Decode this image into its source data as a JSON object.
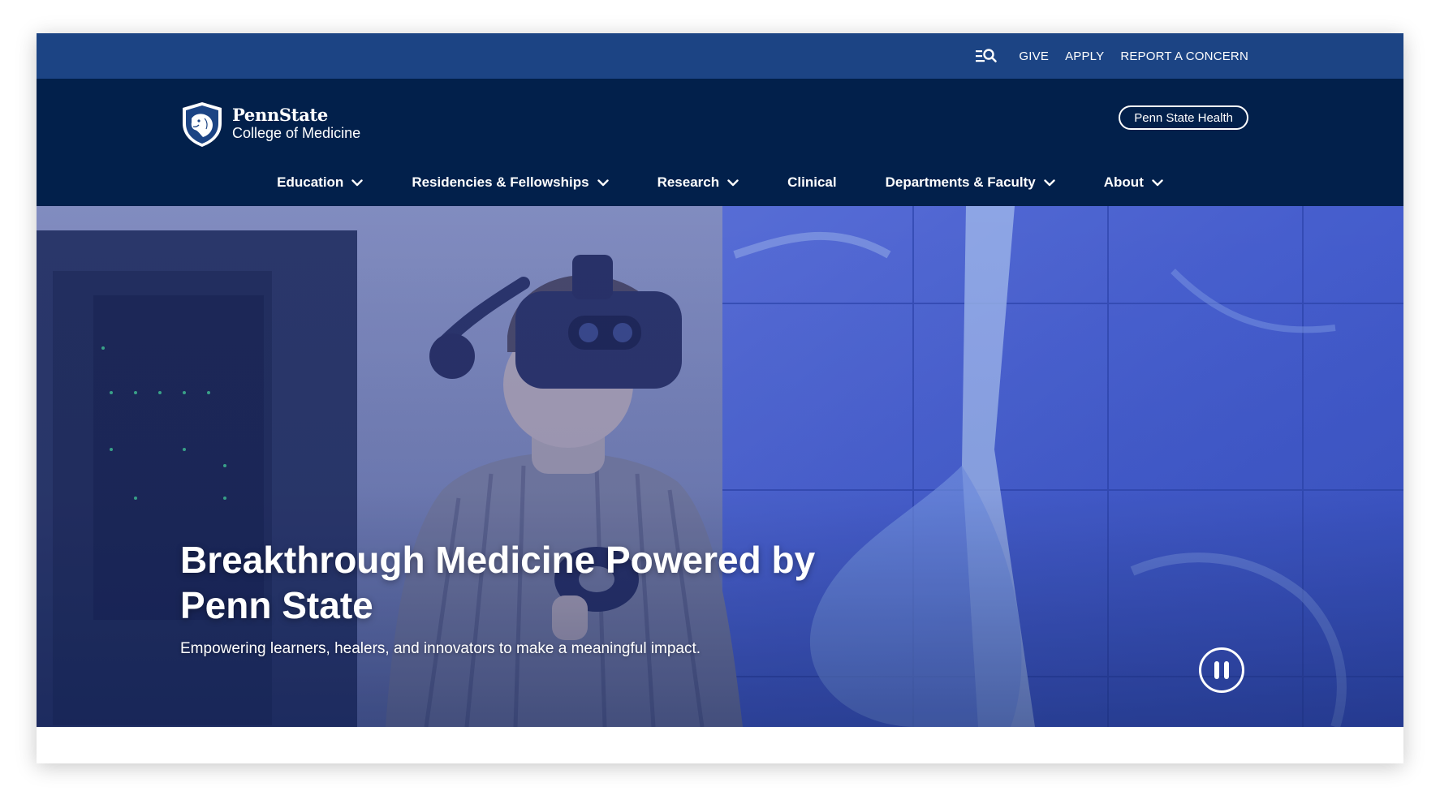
{
  "utility": {
    "search_menu_icon": "search-menu-icon",
    "links": [
      "GIVE",
      "APPLY",
      "REPORT A CONCERN"
    ]
  },
  "header": {
    "brand": "PennState",
    "college": "College of Medicine",
    "logo_icon": "nittany-lion-shield-icon",
    "health_button": "Penn State Health"
  },
  "nav": {
    "items": [
      {
        "label": "Education",
        "dropdown": true
      },
      {
        "label": "Residencies & Fellowships",
        "dropdown": true
      },
      {
        "label": "Research",
        "dropdown": true
      },
      {
        "label": "Clinical",
        "dropdown": false
      },
      {
        "label": "Departments & Faculty",
        "dropdown": true
      },
      {
        "label": "About",
        "dropdown": true
      }
    ]
  },
  "hero": {
    "title": "Breakthrough Medicine Powered by Penn State",
    "subtitle": "Empowering learners, healers, and innovators to make a meaningful impact.",
    "pause_icon": "pause-icon"
  },
  "colors": {
    "utility_bar": "#1c4484",
    "header": "#02204b",
    "hero_overlay": "#1e3a8a"
  }
}
